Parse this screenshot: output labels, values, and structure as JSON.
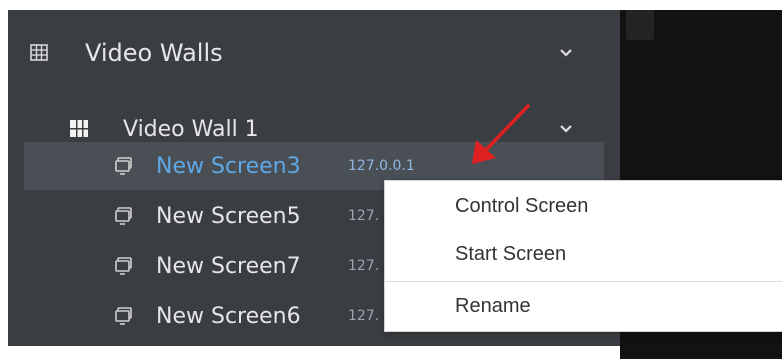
{
  "sidebar": {
    "group": {
      "label": "Video Walls",
      "icon": "grid-icon"
    },
    "wall": {
      "label": "Video Wall 1",
      "icon": "video-wall-icon"
    },
    "screens": [
      {
        "name": "New Screen3",
        "ip": "127.0.0.1",
        "selected": true
      },
      {
        "name": "New Screen5",
        "ip": "127."
      },
      {
        "name": "New Screen7",
        "ip": "127."
      },
      {
        "name": "New Screen6",
        "ip": "127."
      }
    ]
  },
  "context_menu": {
    "items": [
      {
        "label": "Control Screen"
      },
      {
        "label": "Start Screen"
      },
      {
        "label": "Rename"
      }
    ]
  },
  "colors": {
    "panel_bg": "#3a3d42",
    "selected_bg": "#4a4f56",
    "selected_text": "#5fa8e6",
    "annotation_arrow": "#e02020"
  }
}
